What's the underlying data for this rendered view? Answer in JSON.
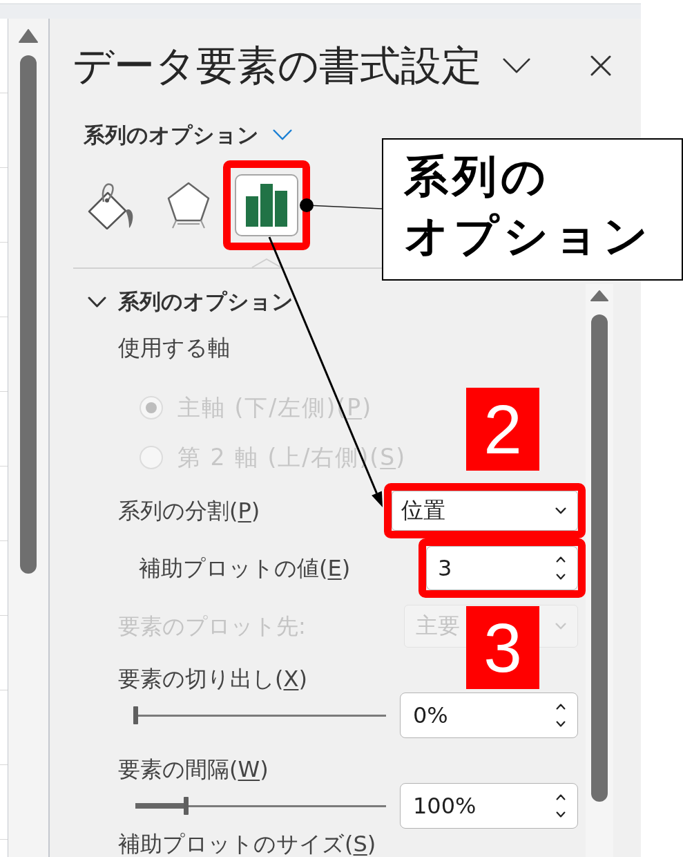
{
  "pane": {
    "title": "データ要素の書式設定"
  },
  "category": {
    "label": "系列のオプション"
  },
  "tabs": [
    {
      "kind": "fill",
      "selected": false,
      "highlighted": false
    },
    {
      "kind": "effects",
      "selected": false,
      "highlighted": false
    },
    {
      "kind": "options",
      "selected": true,
      "highlighted": true,
      "callout": [
        "系列の",
        "オプション"
      ]
    }
  ],
  "section": {
    "title": "系列のオプション",
    "expanded": true,
    "axis_label": "使用する軸",
    "axis_options": [
      {
        "label": "主軸 (下/左側)(",
        "access_key": "P",
        "label_end": ")",
        "selected": true,
        "disabled": true
      },
      {
        "label": "第 2 軸 (上/右側)(",
        "access_key": "S",
        "label_end": ")",
        "selected": false,
        "disabled": true
      }
    ],
    "rows": [
      {
        "kind": "dropdown",
        "label": "系列の分割(",
        "access_key": "P",
        "label_end": ")",
        "value": "位置",
        "disabled": false,
        "highlighted": true,
        "badge": "2",
        "children": [
          {
            "kind": "spinner",
            "label": "補助プロットの値(",
            "access_key": "E",
            "label_end": ")",
            "value": "3",
            "disabled": false,
            "highlighted": true,
            "badge": "3"
          }
        ]
      },
      {
        "kind": "dropdown",
        "label": "要素のプロット先:",
        "value": "主要",
        "disabled": true,
        "highlighted": false
      },
      {
        "kind": "slider",
        "label": "要素の切り出し(",
        "access_key": "X",
        "label_end": ")",
        "level": 0,
        "value": "0%",
        "disabled": false,
        "highlighted": false
      },
      {
        "kind": "slider",
        "label": "要素の間隔(",
        "access_key": "W",
        "label_end": ")",
        "level": 0.2,
        "value": "100%",
        "disabled": false,
        "highlighted": false
      },
      {
        "kind": "caption",
        "label": "補助プロットのサイズ(",
        "access_key": "S",
        "label_end": ")",
        "disabled": false,
        "highlighted": false
      }
    ]
  }
}
